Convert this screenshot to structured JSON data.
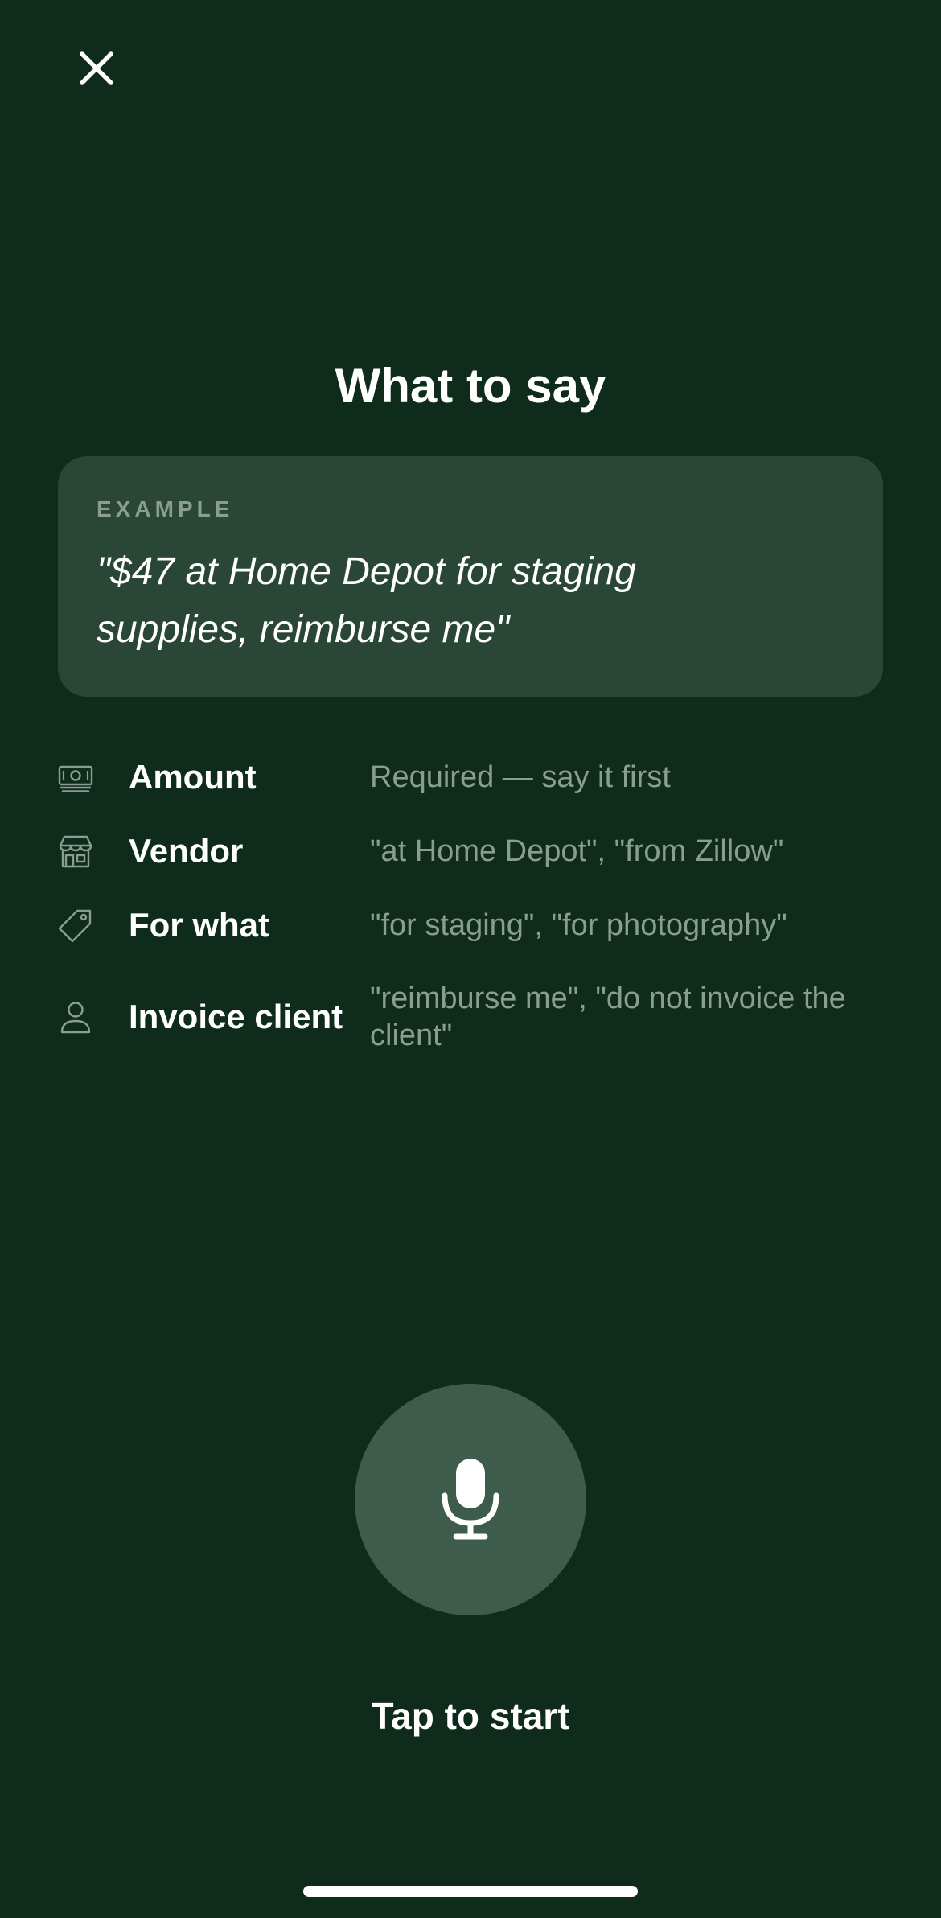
{
  "header": {
    "close_icon": "close-icon"
  },
  "title": "What to say",
  "example": {
    "label": "EXAMPLE",
    "quote": "\"$47 at Home Depot for staging supplies, reimburse me\""
  },
  "hints": [
    {
      "icon": "cash-icon",
      "name": "Amount",
      "description": "Required — say it first"
    },
    {
      "icon": "storefront-icon",
      "name": "Vendor",
      "description": "\"at Home Depot\", \"from Zillow\""
    },
    {
      "icon": "tag-icon",
      "name": "For what",
      "description": "\"for staging\", \"for photography\""
    },
    {
      "icon": "person-icon",
      "name": "Invoice client",
      "description": "\"reimburse me\", \"do not invoice the client\""
    }
  ],
  "mic": {
    "icon": "microphone-icon",
    "label": "Tap to start"
  },
  "colors": {
    "background": "#0e2b1c",
    "card": "#2a4636",
    "mic_button": "#3d5c4b",
    "muted_text": "#8a9d91",
    "text": "#ffffff"
  }
}
